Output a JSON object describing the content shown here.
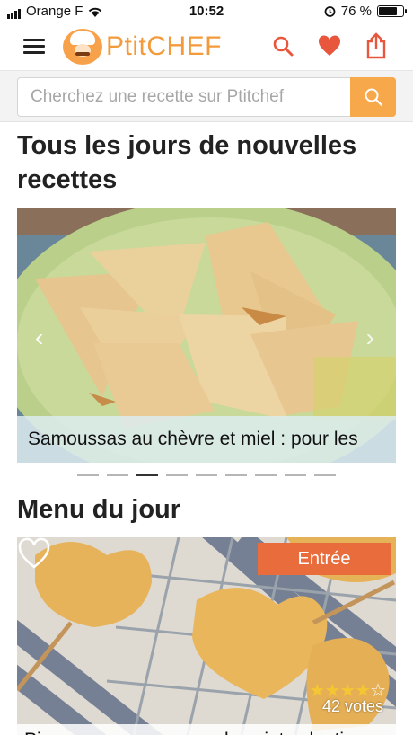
{
  "status_bar": {
    "carrier": "Orange F",
    "time": "10:52",
    "battery": "76 %"
  },
  "header": {
    "logo_text": "PtitCHEF"
  },
  "search": {
    "placeholder": "Cherchez une recette sur Ptitchef"
  },
  "sections": {
    "new_recipes_title": "Tous les jours de nouvelles recettes",
    "menu_title": "Menu du jour"
  },
  "carousel": {
    "caption": "Samoussas au chèvre et miel : pour les",
    "dots_count": 9,
    "active_index": 2
  },
  "menu_card": {
    "badge": "Entrée",
    "rating": 4,
    "rating_max": 5,
    "votes": "42 votes",
    "caption": "Pie pops en coeur pour la saint valentin"
  },
  "colors": {
    "brand_orange": "#f39b3a",
    "heart_red": "#e8573d",
    "badge_orange": "#e96d3c"
  }
}
